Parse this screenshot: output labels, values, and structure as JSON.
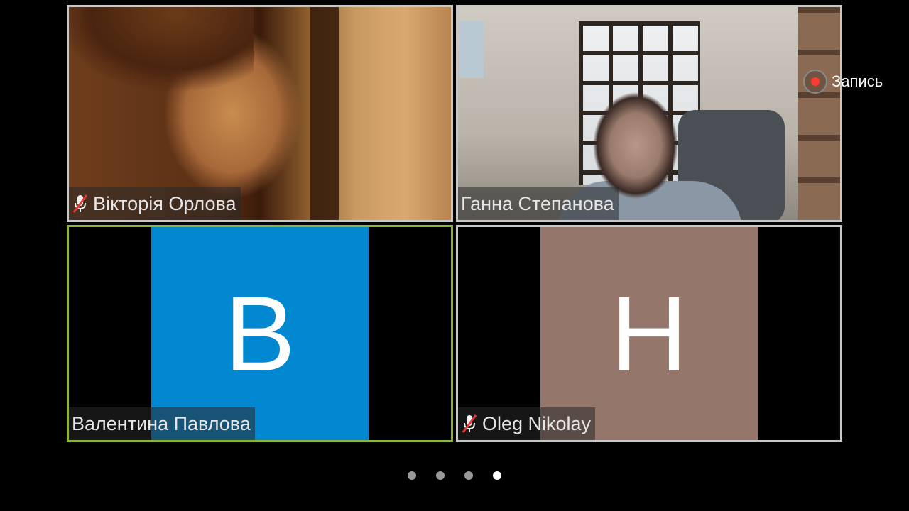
{
  "participants": [
    {
      "name": "Вікторія Орлова",
      "muted": true,
      "video": true
    },
    {
      "name": "Ганна Степанова",
      "muted": false,
      "video": true
    },
    {
      "name": "Валентина Павлова",
      "muted": false,
      "video": false,
      "initial": "B",
      "avatar_color": "#0288d1",
      "active_speaker": true
    },
    {
      "name": "Oleg Nikolay",
      "muted": true,
      "video": false,
      "initial": "H",
      "avatar_color": "#95766a"
    }
  ],
  "recording": {
    "label": "Запись",
    "icon": "record-icon"
  },
  "pager": {
    "pages": 4,
    "current": 4
  },
  "colors": {
    "active_border": "#8db33a",
    "tile_border": "#c8c8c8",
    "record_red": "#ff3b30"
  }
}
